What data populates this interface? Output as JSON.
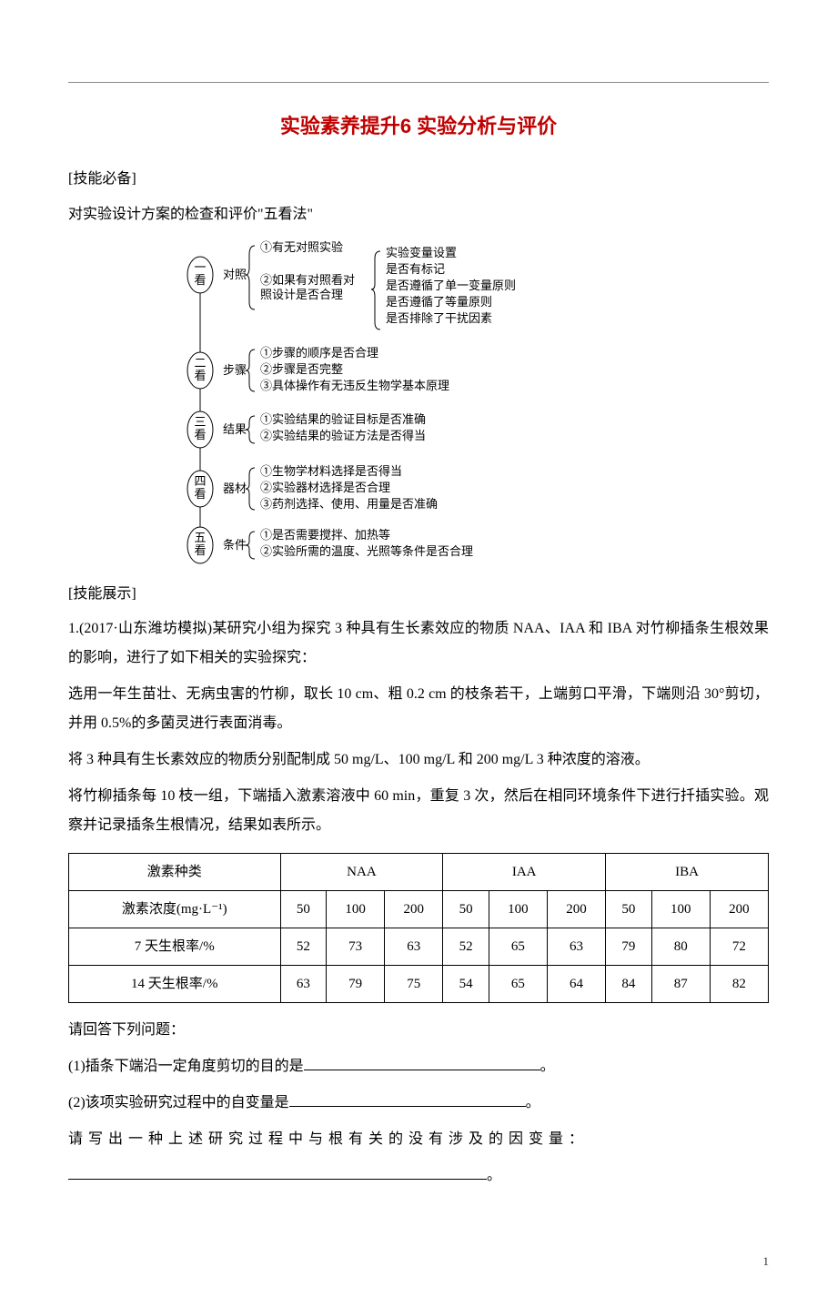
{
  "title": "实验素养提升6 实验分析与评价",
  "labels": {
    "skill_prep": "[技能必备]",
    "skill_show": "[技能展示]"
  },
  "intro": "对实验设计方案的检查和评价\"五看法\"",
  "diagram": {
    "nodes": [
      {
        "num": "一",
        "sub": "看",
        "tag": "对照"
      },
      {
        "num": "二",
        "sub": "看",
        "tag": "步骤"
      },
      {
        "num": "三",
        "sub": "看",
        "tag": "结果"
      },
      {
        "num": "四",
        "sub": "看",
        "tag": "器材"
      },
      {
        "num": "五",
        "sub": "看",
        "tag": "条件"
      }
    ],
    "group1_left": {
      "a": "①有无对照实验",
      "b1": "②如果有对照看对",
      "b2": "照设计是否合理"
    },
    "group1_right": [
      "实验变量设置",
      "是否有标记",
      "是否遵循了单一变量原则",
      "是否遵循了等量原则",
      "是否排除了干扰因素"
    ],
    "group2": [
      "①步骤的顺序是否合理",
      "②步骤是否完整",
      "③具体操作有无违反生物学基本原理"
    ],
    "group3": [
      "①实验结果的验证目标是否准确",
      "②实验结果的验证方法是否得当"
    ],
    "group4": [
      "①生物学材料选择是否得当",
      "②实验器材选择是否合理",
      "③药剂选择、使用、用量是否准确"
    ],
    "group5": [
      "①是否需要搅拌、加热等",
      "②实验所需的温度、光照等条件是否合理"
    ]
  },
  "question": {
    "lead": "1.(2017·山东潍坊模拟)某研究小组为探究 3 种具有生长素效应的物质 NAA、IAA 和 IBA 对竹柳插条生根效果的影响，进行了如下相关的实验探究：",
    "step1": "选用一年生苗壮、无病虫害的竹柳，取长 10 cm、粗 0.2 cm 的枝条若干，上端剪口平滑，下端则沿 30°剪切，并用 0.5%的多菌灵进行表面消毒。",
    "step2": "将 3 种具有生长素效应的物质分别配制成 50 mg/L、100 mg/L 和 200 mg/L 3 种浓度的溶液。",
    "step3": "将竹柳插条每 10 枝一组，下端插入激素溶液中 60 min，重复 3 次，然后在相同环境条件下进行扦插实验。观察并记录插条生根情况，结果如表所示。"
  },
  "chart_data": {
    "type": "table",
    "header_row1": [
      "激素种类",
      "NAA",
      "IAA",
      "IBA"
    ],
    "header_row2_label": "激素浓度(mg·L⁻¹)",
    "concentrations": [
      "50",
      "100",
      "200"
    ],
    "rows": [
      {
        "label": "7 天生根率/%",
        "NAA": [
          52,
          73,
          63
        ],
        "IAA": [
          52,
          65,
          63
        ],
        "IBA": [
          79,
          80,
          72
        ]
      },
      {
        "label": "14 天生根率/%",
        "NAA": [
          63,
          79,
          75
        ],
        "IAA": [
          54,
          65,
          64
        ],
        "IBA": [
          84,
          87,
          82
        ]
      }
    ]
  },
  "answers": {
    "prompt": "请回答下列问题：",
    "q1": "(1)插条下端沿一定角度剪切的目的是",
    "q1_end": "。",
    "q2": "(2)该项实验研究过程中的自变量是",
    "q2_end": "。",
    "q2b": "请写出一种上述研究过程中与根有关的没有涉及的因变量：",
    "q2b_end": "。"
  },
  "page_number": "1"
}
